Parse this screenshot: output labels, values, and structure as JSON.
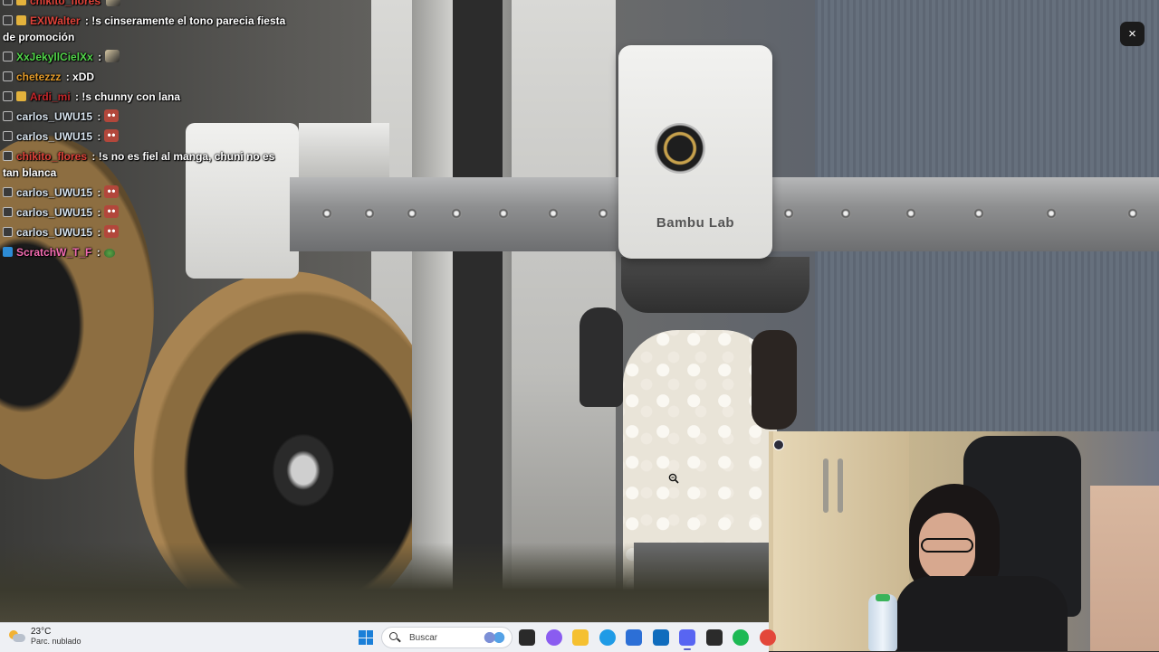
{
  "chat": {
    "messages": [
      {
        "badges": [
          "sub",
          "gold"
        ],
        "user": "chikito_flores",
        "user_color": "#e0433a",
        "text": "",
        "emote": "avatar"
      },
      {
        "badges": [
          "sub",
          "gold"
        ],
        "user": "EXIWalter",
        "user_color": "#e0433a",
        "text": ": !s cinseramente el tono parecia fiesta de promoción",
        "emote": null
      },
      {
        "badges": [
          "sub"
        ],
        "user": "XxJekyllCielXx",
        "user_color": "#52d64a",
        "text": ":",
        "emote": "avatar"
      },
      {
        "badges": [
          "sub"
        ],
        "user": "chetezzz",
        "user_color": "#e39b2a",
        "text": ": xDD",
        "emote": null
      },
      {
        "badges": [
          "sub",
          "gold"
        ],
        "user": "Ardi_mi",
        "user_color": "#c4272b",
        "text": ": !s chunny con lana",
        "emote": null
      },
      {
        "badges": [
          "sub"
        ],
        "user": "carlos_UWU15",
        "user_color": "#d7e3ee",
        "text": ":",
        "emote": "face"
      },
      {
        "badges": [
          "sub"
        ],
        "user": "carlos_UWU15",
        "user_color": "#d7e3ee",
        "text": ":",
        "emote": "face"
      },
      {
        "badges": [
          "sub"
        ],
        "user": "chikito_flores",
        "user_color": "#e0433a",
        "text": ": !s no es fiel al manga, chuni no es tan blanca",
        "emote": null
      },
      {
        "badges": [
          "sub"
        ],
        "user": "carlos_UWU15",
        "user_color": "#d7e3ee",
        "text": ":",
        "emote": "face"
      },
      {
        "badges": [
          "sub"
        ],
        "user": "carlos_UWU15",
        "user_color": "#d7e3ee",
        "text": ":",
        "emote": "face"
      },
      {
        "badges": [
          "sub"
        ],
        "user": "carlos_UWU15",
        "user_color": "#d7e3ee",
        "text": ":",
        "emote": "face"
      },
      {
        "badges": [
          "blue"
        ],
        "user": "ScratchW_T_F",
        "user_color": "#f36bb1",
        "text": ":",
        "emote": "earth"
      }
    ]
  },
  "stream": {
    "printer_brand": "Bambu Lab",
    "close_icon": "×"
  },
  "taskbar": {
    "weather_temp": "23°C",
    "weather_desc": "Parc. nublado",
    "search_placeholder": "Buscar",
    "apps": [
      {
        "name": "task-view",
        "color": "#2a2a2a"
      },
      {
        "name": "copilot",
        "color": "#8a5cf0"
      },
      {
        "name": "file-explorer",
        "color": "#f5c030"
      },
      {
        "name": "edge",
        "color": "#1f9be6"
      },
      {
        "name": "microsoft-store",
        "color": "#2c6fd6"
      },
      {
        "name": "outlook",
        "color": "#0f6cbd"
      },
      {
        "name": "discord",
        "color": "#5865f2"
      },
      {
        "name": "terminal",
        "color": "#2b2b2b"
      },
      {
        "name": "spotify",
        "color": "#1db954"
      },
      {
        "name": "chrome",
        "color": "#e3473a"
      }
    ]
  }
}
